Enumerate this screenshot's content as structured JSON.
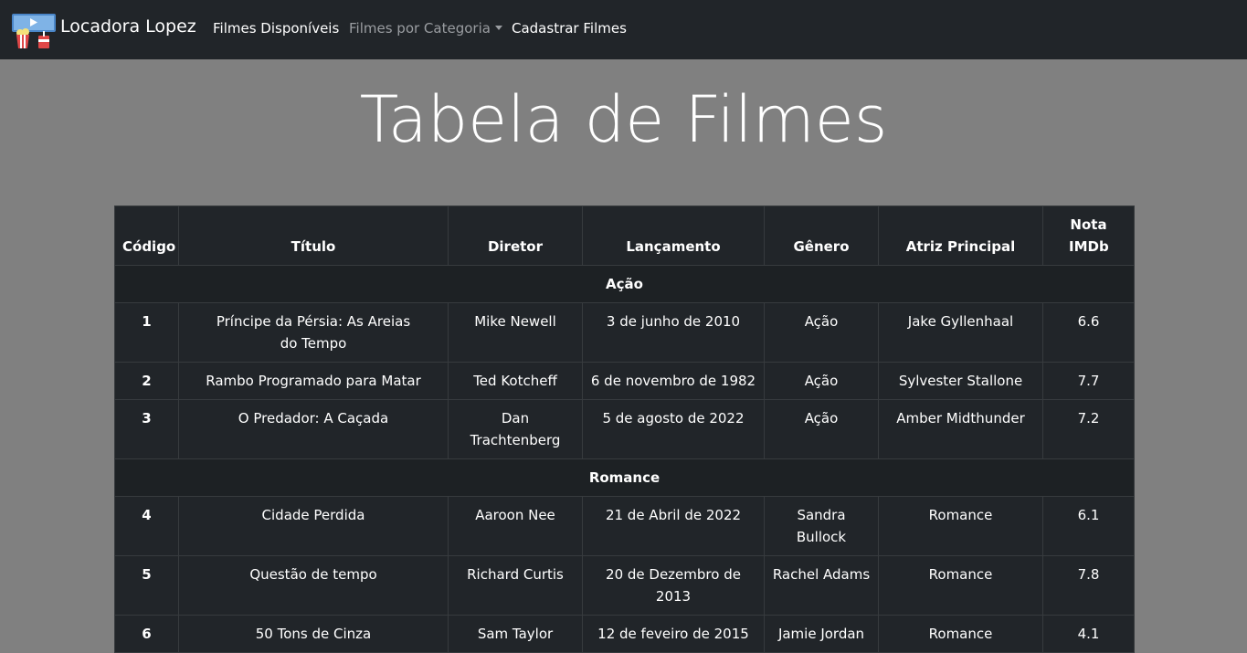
{
  "navbar": {
    "brand": "Locadora Lopez",
    "links": [
      {
        "label": "Filmes Disponíveis"
      },
      {
        "label": "Filmes por Categoria"
      },
      {
        "label": "Cadastrar Filmes"
      }
    ]
  },
  "page": {
    "title": "Tabela de Filmes"
  },
  "table": {
    "headers": [
      "Código",
      "Título",
      "Diretor",
      "Lançamento",
      "Gênero",
      "Atriz Principal",
      "Nota IMDb"
    ],
    "groups": [
      {
        "name": "Ação",
        "rows": [
          [
            "1",
            "Príncipe da Pérsia: As Areias do Tempo",
            "Mike Newell",
            "3 de junho de 2010",
            "Ação",
            "Jake Gyllenhaal",
            "6.6"
          ],
          [
            "2",
            "Rambo Programado para Matar",
            "Ted Kotcheff",
            "6 de novembro de 1982",
            "Ação",
            "Sylvester Stallone",
            "7.7"
          ],
          [
            "3",
            "O Predador: A Caçada",
            "Dan Trachtenberg",
            "5 de agosto de 2022",
            "Ação",
            "Amber Midthunder",
            "7.2"
          ]
        ]
      },
      {
        "name": "Romance",
        "rows": [
          [
            "4",
            "Cidade Perdida",
            "Aaroon Nee",
            "21 de Abril de 2022",
            "Sandra Bullock",
            "Romance",
            "6.1"
          ],
          [
            "5",
            "Questão de tempo",
            "Richard Curtis",
            "20 de Dezembro de 2013",
            "Rachel Adams",
            "Romance",
            "7.8"
          ],
          [
            "6",
            "50 Tons de Cinza",
            "Sam Taylor",
            "12 de feveiro de 2015",
            "Jamie Jordan",
            "Romance",
            "4.1"
          ]
        ]
      }
    ]
  }
}
